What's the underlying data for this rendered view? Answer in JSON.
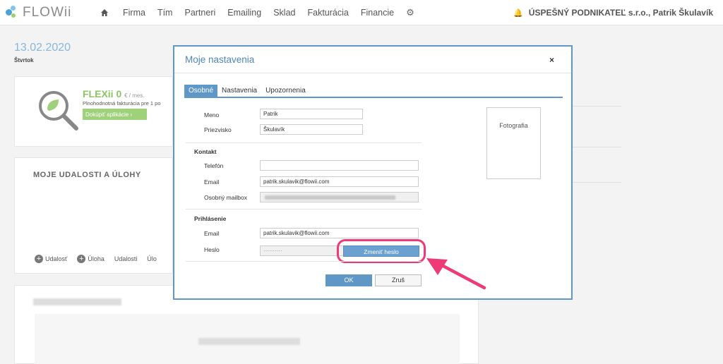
{
  "app": {
    "logo_text": "FLOWii",
    "nav": [
      "Firma",
      "Tím",
      "Partneri",
      "Emailing",
      "Sklad",
      "Fakturácia",
      "Financie"
    ],
    "company": "ÚSPEŠNÝ PODNIKATEĽ s.r.o., Patrik Škulavík"
  },
  "dashboard": {
    "date": "13.02.2020",
    "day": "Štvrtok",
    "flexii": {
      "title": "FLEXii 0",
      "price_suffix": "€ / mes.",
      "desc": "Plnohodnotná fakturácia pre 1 po",
      "button": "Dokúpiť aplikácie ›"
    },
    "events": {
      "title": "MOJE UDALOSTI A ÚLOHY",
      "add_event": "Udalosť",
      "add_task": "Úloha",
      "events_link": "Udalosti",
      "tasks_link": "Úlo"
    }
  },
  "modal": {
    "title": "Moje nastavenia",
    "close": "×",
    "tabs": [
      "Osobné",
      "Nastavenia",
      "Upozornenia"
    ],
    "fields": {
      "meno_label": "Meno",
      "meno_value": "Patrik",
      "priezvisko_label": "Priezvisko",
      "priezvisko_value": "Škulavík",
      "kontakt_section": "Kontakt",
      "telefon_label": "Telefón",
      "telefon_value": "",
      "email_label": "Email",
      "email_value": "patrik.skulavik@flowii.com",
      "mailbox_label": "Osobný mailbox",
      "login_section": "Prihlásenie",
      "login_email_label": "Email",
      "login_email_value": "patrik.skulavik@flowii.com",
      "password_label": "Heslo",
      "password_value": "··········"
    },
    "photo_label": "Fotografia",
    "change_password": "Zmeniť heslo",
    "ok": "OK",
    "cancel": "Zruš"
  },
  "colors": {
    "accent": "#5f97c7",
    "highlight": "#ee3a76",
    "green": "#8cc563"
  }
}
